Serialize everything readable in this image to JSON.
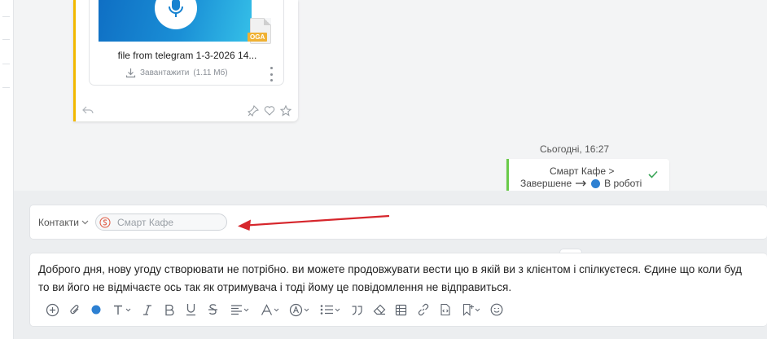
{
  "message": {
    "file": {
      "name": "file from telegram 1-3-2026 14...",
      "extension": "OGA",
      "download_label": "Завантажити",
      "size": "(1.11 Мб)"
    }
  },
  "timeline": {
    "date_label": "Сьогодні, 16:27",
    "event": {
      "title": "Смарт Кафе  >",
      "from_status": "Завершене",
      "to_status": "В роботі",
      "to_status_color": "#2d80d2"
    }
  },
  "composer": {
    "contacts_label": "Контакти",
    "contact_chip": "Смарт Кафе",
    "text_line1": "Доброго дня, нову угоду створювати не потрібно. ви можете продовжувати вести цю в якій ви з клієнтом і спілкуєтеся. Єдине що коли буд",
    "text_line2": "то ви його не відмічаєте ось так як отримувача і тоді йому це повідомлення не відправиться.",
    "toolbar_icons": [
      "plus-circle-icon",
      "paperclip-icon",
      "text-color-icon",
      "text-size-icon",
      "italic-icon",
      "bold-icon",
      "underline-icon",
      "strikethrough-icon",
      "align-icon",
      "font-icon",
      "font-style-icon",
      "list-icon",
      "quote-icon",
      "eraser-icon",
      "table-icon",
      "link-icon",
      "code-icon",
      "bookmark-icon",
      "emoji-icon"
    ]
  },
  "colors": {
    "accent_message": "#f2b800",
    "accent_event": "#6acb4a",
    "annotation_arrow": "#d6262c",
    "file_badge": "#f0b132"
  }
}
